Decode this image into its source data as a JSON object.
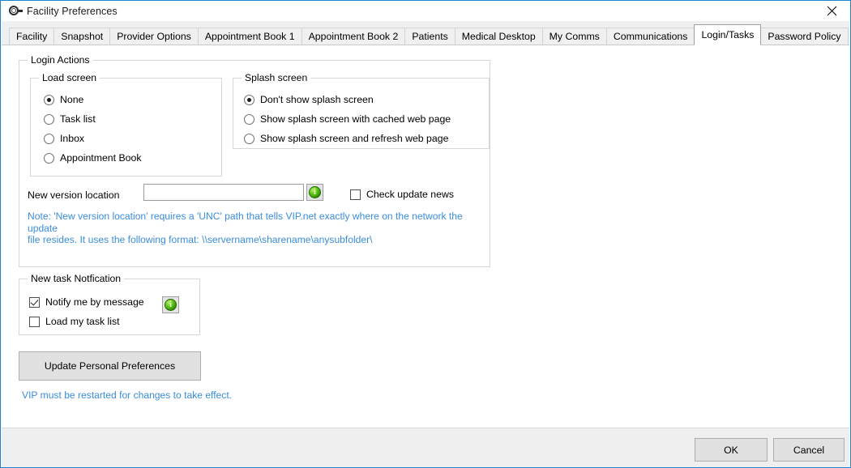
{
  "window": {
    "title": "Facility Preferences",
    "icon": "target-gear-icon",
    "close_label": "✕",
    "border_color": "#1b84d0"
  },
  "tabs": [
    {
      "label": "Facility",
      "active": false
    },
    {
      "label": "Snapshot",
      "active": false
    },
    {
      "label": "Provider Options",
      "active": false
    },
    {
      "label": "Appointment Book 1",
      "active": false
    },
    {
      "label": "Appointment Book 2",
      "active": false
    },
    {
      "label": "Patients",
      "active": false
    },
    {
      "label": "Medical Desktop",
      "active": false
    },
    {
      "label": "My Comms",
      "active": false
    },
    {
      "label": "Communications",
      "active": false
    },
    {
      "label": "Login/Tasks",
      "active": true
    },
    {
      "label": "Password Policy",
      "active": false
    }
  ],
  "login_actions": {
    "legend": "Login Actions",
    "load_screen": {
      "legend": "Load screen",
      "options": [
        {
          "label": "None",
          "selected": true
        },
        {
          "label": "Task list",
          "selected": false
        },
        {
          "label": "Inbox",
          "selected": false
        },
        {
          "label": "Appointment Book",
          "selected": false
        }
      ]
    },
    "splash_screen": {
      "legend": "Splash screen",
      "options": [
        {
          "label": "Don't show splash screen",
          "selected": true
        },
        {
          "label": "Show splash screen with cached web page",
          "selected": false
        },
        {
          "label": "Show splash screen and refresh web page",
          "selected": false
        }
      ]
    },
    "new_version": {
      "label": "New version location",
      "value": "",
      "placeholder": "",
      "info_button_icon": "green-info-globe-icon"
    },
    "check_update_news": {
      "label": "Check update news",
      "checked": false
    },
    "note_line1": "Note: 'New version location' requires a 'UNC' path that tells VIP.net exactly where on the network the update",
    "note_line2": "file resides. It uses the following format:  \\\\servername\\sharename\\anysubfolder\\",
    "note_color": "#3a8ddd"
  },
  "new_task_notification": {
    "legend": "New task Notfication",
    "notify_by_message": {
      "label": "Notify me by message",
      "checked": true
    },
    "load_my_task_list": {
      "label": "Load my task list",
      "checked": false
    },
    "info_button_icon": "green-info-globe-icon"
  },
  "update_button": {
    "label": "Update Personal Preferences"
  },
  "restart_note": {
    "text": "VIP must be restarted for changes to take effect.",
    "color": "#3a8ddd"
  },
  "footer": {
    "ok_label": "OK",
    "cancel_label": "Cancel"
  }
}
